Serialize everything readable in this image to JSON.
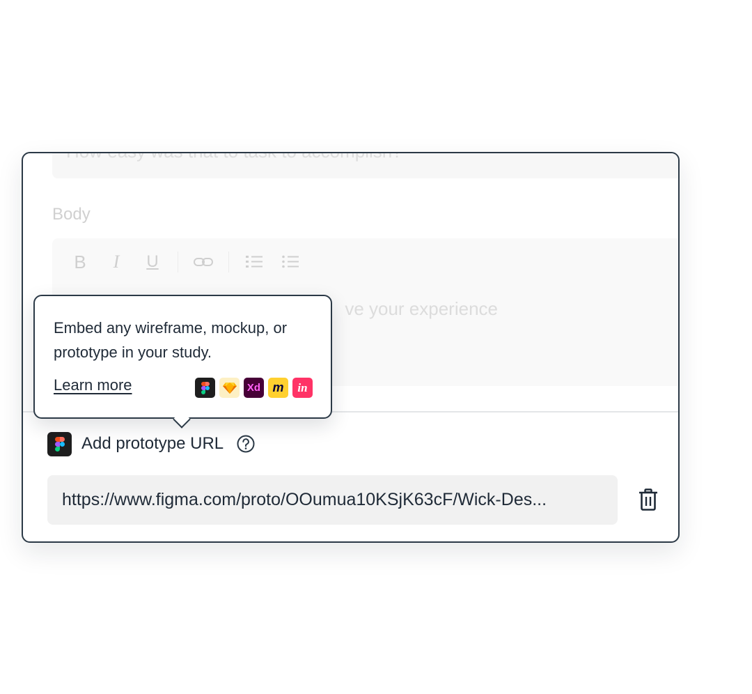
{
  "question": {
    "title_placeholder": "How easy was that to task to accomplish?",
    "body_label": "Body",
    "body_placeholder": "ve your experience"
  },
  "toolbar": {
    "buttons": [
      "bold",
      "italic",
      "underline",
      "link",
      "numbered-list",
      "bulleted-list"
    ],
    "bold_glyph": "B",
    "italic_glyph": "I",
    "underline_glyph": "U"
  },
  "tooltip": {
    "text": "Embed any wireframe, mockup, or prototype in your study.",
    "link_label": "Learn more",
    "tool_icons": [
      "figma-icon",
      "sketch-icon",
      "adobe-xd-icon",
      "miro-icon",
      "invision-icon"
    ],
    "xd_label": "Xd",
    "miro_label": "m",
    "invision_label": "in"
  },
  "prototype": {
    "label": "Add prototype URL",
    "url": "https://www.figma.com/proto/OOumua10KSjK63cF/Wick-Des..."
  },
  "colors": {
    "border": "#2b3946",
    "text": "#1f2a37",
    "field_bg": "#f1f1f1",
    "sketch": "#fdb300",
    "xd_bg": "#470137",
    "xd_fg": "#ff61f6",
    "miro": "#ffd02f",
    "invision": "#ff3366"
  }
}
